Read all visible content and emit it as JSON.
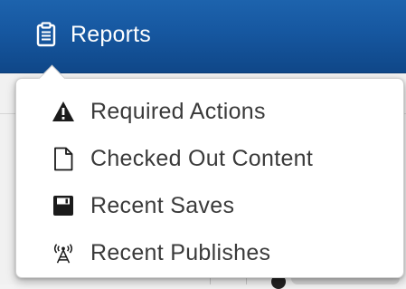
{
  "navbar": {
    "reports_label": "Reports",
    "reports_icon": "clipboard-icon",
    "background_color": "#1657a0",
    "text_color": "#ffffff"
  },
  "dropdown": {
    "items": [
      {
        "label": "Required Actions",
        "icon": "warning-icon"
      },
      {
        "label": "Checked Out Content",
        "icon": "document-icon"
      },
      {
        "label": "Recent Saves",
        "icon": "floppy-disk-icon"
      },
      {
        "label": "Recent Publishes",
        "icon": "broadcast-tower-icon"
      }
    ],
    "text_color": "#3a3a3a",
    "background_color": "#ffffff"
  }
}
